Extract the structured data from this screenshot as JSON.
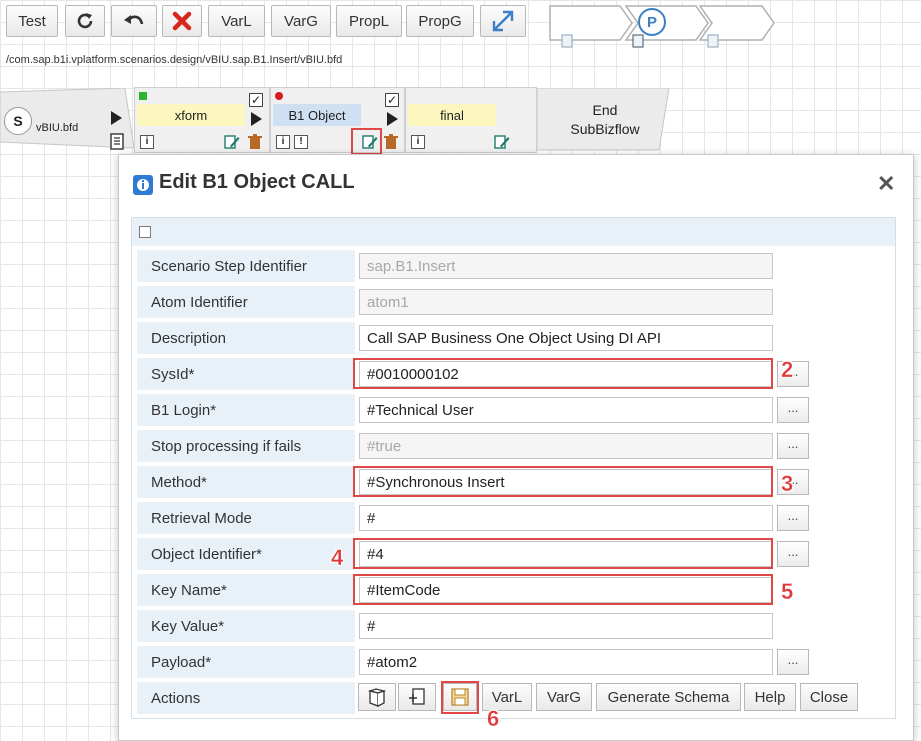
{
  "toolbar": {
    "test": "Test",
    "varl": "VarL",
    "varg": "VarG",
    "propl": "PropL",
    "propg": "PropG"
  },
  "nav": {
    "p_label": "P"
  },
  "path": "/com.sap.b1i.vplatform.scenarios.design/vBIU.sap.B1.Insert/vBIU.bfd",
  "flow": {
    "start_badge": "S",
    "start_label": "vBIU.bfd",
    "steps": [
      {
        "label": "xform",
        "color": "#fbf7bf"
      },
      {
        "label": "B1 Object",
        "color": "#cfe0f3"
      },
      {
        "label": "final",
        "color": "#fbf7bf"
      }
    ],
    "end_line1": "End",
    "end_line2": "SubBizflow"
  },
  "dialog": {
    "title": "Edit B1 Object CALL",
    "close": "✕",
    "rows": [
      {
        "label": "Scenario Step Identifier",
        "value": "sap.B1.Insert",
        "disabled": true
      },
      {
        "label": "Atom Identifier",
        "value": "atom1",
        "disabled": true
      },
      {
        "label": "Description",
        "value": "Call SAP Business One Object Using DI API"
      },
      {
        "label": "SysId*",
        "value": "#0010000102"
      },
      {
        "label": "B1 Login*",
        "value": "#Technical User"
      },
      {
        "label": "Stop processing if fails",
        "value": "#true",
        "disabled": true
      },
      {
        "label": "Method*",
        "value": "#Synchronous Insert"
      },
      {
        "label": "Retrieval Mode",
        "value": "#"
      },
      {
        "label": "Object Identifier*",
        "value": "#4"
      },
      {
        "label": "Key Name*",
        "value": "#ItemCode"
      },
      {
        "label": "Key Value*",
        "value": "#"
      },
      {
        "label": "Payload*",
        "value": "#atom2"
      }
    ],
    "dots": "...",
    "actions_label": "Actions",
    "actions": {
      "varl": "VarL",
      "varg": "VarG",
      "generate_schema": "Generate Schema",
      "help": "Help",
      "close": "Close"
    }
  },
  "callouts": [
    "1",
    "2",
    "3",
    "4",
    "5",
    "6"
  ],
  "colors": {
    "highlight": "#e04848",
    "form_label_bg": "#e9f1f8",
    "undo_red": "#d9261c"
  }
}
